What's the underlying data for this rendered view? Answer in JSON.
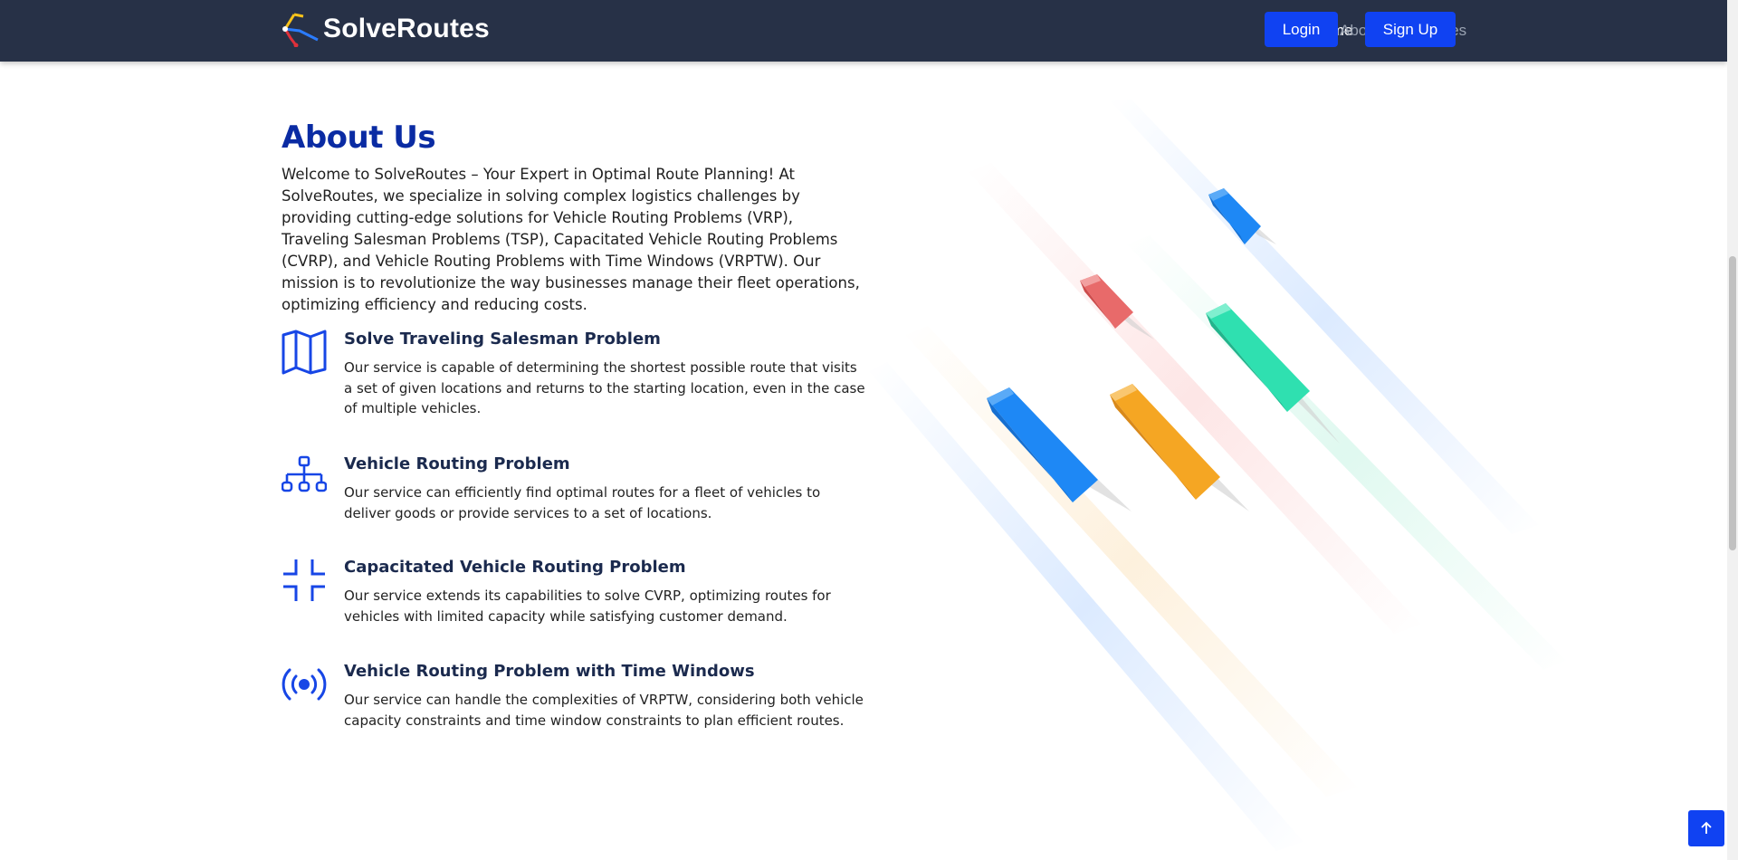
{
  "brand": {
    "name": "SolveRoutes"
  },
  "nav": {
    "links": [
      {
        "label": "Home",
        "active": true
      },
      {
        "label": "About",
        "active": false
      },
      {
        "label": "Services",
        "active": false
      }
    ],
    "login_label": "Login",
    "signup_label": "Sign Up"
  },
  "about": {
    "title": "About Us",
    "intro": "Welcome to SolveRoutes – Your Expert in Optimal Route Planning! At SolveRoutes, we specialize in solving complex logistics challenges by providing cutting-edge solutions for Vehicle Routing Problems (VRP), Traveling Salesman Problems (TSP), Capacitated Vehicle Routing Problems (CVRP), and Vehicle Routing Problems with Time Windows (VRPTW). Our mission is to revolutionize the way businesses manage their fleet operations, optimizing efficiency and reducing costs.",
    "features": [
      {
        "icon": "map-icon",
        "title": "Solve Traveling Salesman Problem",
        "description": "Our service is capable of determining the shortest possible route that visits a set of given locations and returns to the starting location, even in the case of multiple vehicles."
      },
      {
        "icon": "diagram-icon",
        "title": "Vehicle Routing Problem",
        "description": "Our service can efficiently find optimal routes for a fleet of vehicles to deliver goods or provide services to a set of locations."
      },
      {
        "icon": "fullscreen-exit-icon",
        "title": "Capacitated Vehicle Routing Problem",
        "description": "Our service extends its capabilities to solve CVRP, optimizing routes for vehicles with limited capacity while satisfying customer demand."
      },
      {
        "icon": "broadcast-icon",
        "title": "Vehicle Routing Problem with Time Windows",
        "description": "Our service can handle the complexities of VRPTW, considering both vehicle capacity constraints and time window constraints to plan efficient routes."
      }
    ]
  },
  "colors": {
    "navbar": "#273147",
    "accent": "#1042f2",
    "title": "#0a2ba3",
    "icon": "#1746e6"
  },
  "back_to_top": {
    "icon": "arrow-up-icon"
  }
}
